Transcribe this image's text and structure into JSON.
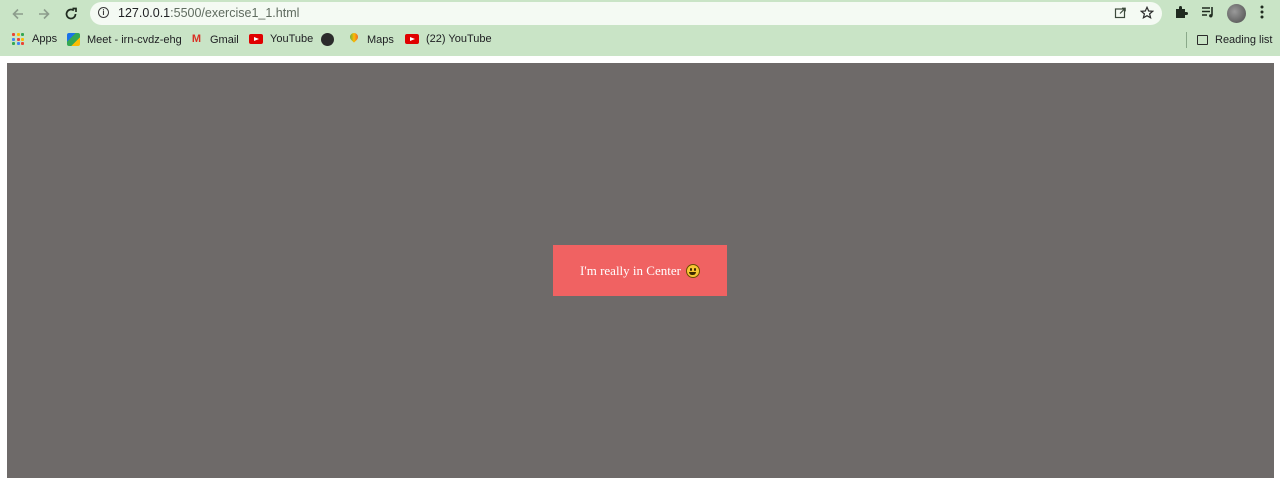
{
  "browser": {
    "url_host": "127.0.0.1",
    "url_rest": ":5500/exercise1_1.html",
    "icons": {
      "back": "arrow-left-icon",
      "forward": "arrow-right-icon",
      "reload": "reload-icon",
      "site_info": "info-icon",
      "share": "share-icon",
      "bookmark": "star-icon",
      "extensions": "puzzle-icon",
      "media": "media-queue-icon",
      "menu": "kebab-menu-icon"
    }
  },
  "bookmarks": {
    "items": [
      {
        "label": "Apps",
        "icon": "apps-grid-icon"
      },
      {
        "label": "Meet - irn-cvdz-ehg",
        "icon": "meet-icon"
      },
      {
        "label": "Gmail",
        "icon": "gmail-icon"
      },
      {
        "label": "YouTube",
        "icon": "youtube-icon"
      },
      {
        "label": "",
        "icon": "globe-icon"
      },
      {
        "label": "Maps",
        "icon": "maps-icon"
      },
      {
        "label": "(22) YouTube",
        "icon": "youtube-icon"
      }
    ],
    "reading_list": "Reading list"
  },
  "page": {
    "center_text": "I'm really in Center",
    "emoji": "smiley-icon",
    "background_color": "#6e6a69",
    "box_color": "#f06262"
  },
  "colors": {
    "chrome_frame": "#c9e4c6",
    "omnibox": "#f4faf3"
  }
}
